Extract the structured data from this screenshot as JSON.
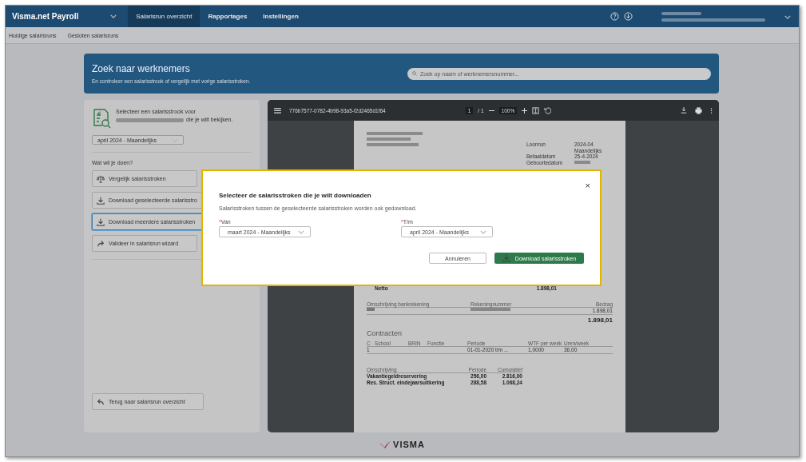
{
  "header": {
    "app_title": "Visma.net Payroll",
    "nav": [
      {
        "label": "Salarisrun overzicht",
        "selected": true
      },
      {
        "label": "Rapportages",
        "selected": false
      },
      {
        "label": "Instellingen",
        "selected": false
      }
    ]
  },
  "subnav": {
    "items": [
      "Huidige salarisruns",
      "Gesloten salarisruns"
    ]
  },
  "search_banner": {
    "title": "Zoek naar werknemers",
    "subtitle": "En controleer een salarisstrook of vergelijk met vorige salarisstroken.",
    "search": {
      "placeholder": "Zoek op naam of werknemersnummer..."
    }
  },
  "left_panel": {
    "intro_before": "Selecteer een salarisstrook voor",
    "intro_after": "die je wilt bekijken.",
    "payslip_select": {
      "value": "april 2024 - Maandelijks"
    },
    "section_label": "Wat wil je doen?",
    "actions": [
      {
        "label": "Vergelijk salarisstroken",
        "kind": "compare",
        "selected": false
      },
      {
        "label": "Download geselecteerde salarisstro",
        "kind": "download",
        "selected": false
      },
      {
        "label": "Download meerdere salarisstroken",
        "kind": "download",
        "selected": true
      },
      {
        "label": "Valideer in salarisrun wizard",
        "kind": "forward",
        "selected": false
      }
    ],
    "back_button": "Terug naar salarisrun overzicht"
  },
  "pdf_viewer": {
    "file_name": "776b7577-0782-4b98-93a5-f2d2465d1f64",
    "page": "1",
    "page_total": "/ 1",
    "zoom": "100%",
    "document": {
      "info": [
        {
          "label": "Loonrun",
          "value": "2024-04"
        },
        {
          "value": "Maandelijks"
        },
        {
          "label": "Betaaldatum",
          "value": "25-4-2024"
        },
        {
          "label": "Geboortedatum"
        }
      ],
      "net_label": "Netto",
      "net_value": "1.898,01",
      "bank_columns": [
        "Omschrijving bankrekening",
        "Rekeningnummer",
        "Bedrag"
      ],
      "bank_amount": "1.898,01",
      "bank_total": "1.898,01",
      "contracts_title": "Contracten",
      "contract_columns": [
        "C",
        "School",
        "BRIN",
        "Functie",
        "Periode",
        "WTF per week",
        "Uren/week"
      ],
      "contract_row": {
        "c": "1",
        "periode": "01-01-2020 t/m ...",
        "wtf_per_week": "1,0000",
        "uren_per_week": "36,00"
      },
      "reserve_columns": [
        "Omschrijving",
        "Periode",
        "Cumulatief"
      ],
      "reserve_rows": [
        [
          "Vakantiegeldreservering",
          "256,00",
          "2.816,00"
        ],
        [
          "Res. Struct. eindejaarsuitkering",
          "288,58",
          "1.068,24"
        ]
      ]
    }
  },
  "modal": {
    "close": "×",
    "title": "Selecteer de salarisstroken die je wilt downloaden",
    "description": "Salarisstroken tussen de geselecteerde salarisstroken worden ook gedownload.",
    "fields": [
      {
        "required_mark": "*",
        "label": "Van",
        "value": "maart 2024 - Maandelijks"
      },
      {
        "required_mark": "*",
        "label": "T/m",
        "value": "april 2024 - Maandelijks"
      }
    ],
    "cancel_button": "Annuleren",
    "confirm_button": "Download salarisstroken"
  },
  "footer": {
    "logo": "VISMA"
  }
}
